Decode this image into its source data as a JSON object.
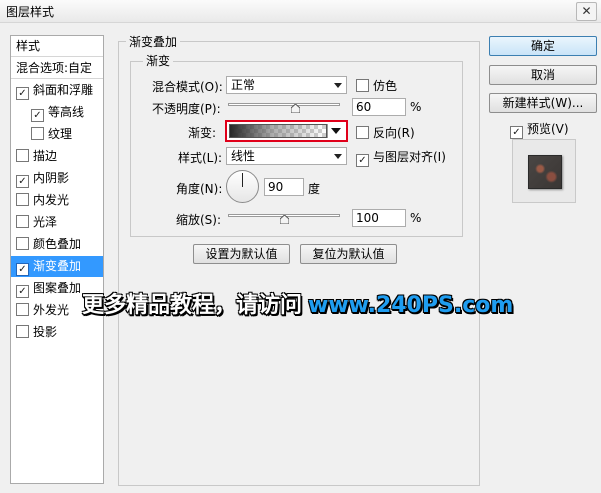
{
  "window": {
    "title": "图层样式",
    "close_glyph": "✕"
  },
  "left_list": {
    "header": "样式",
    "blend_options": "混合选项:自定",
    "items": [
      {
        "label": "斜面和浮雕",
        "checked": true,
        "indent": false
      },
      {
        "label": "等高线",
        "checked": true,
        "indent": true
      },
      {
        "label": "纹理",
        "checked": false,
        "indent": true
      },
      {
        "label": "描边",
        "checked": false,
        "indent": false
      },
      {
        "label": "内阴影",
        "checked": true,
        "indent": false
      },
      {
        "label": "内发光",
        "checked": false,
        "indent": false
      },
      {
        "label": "光泽",
        "checked": false,
        "indent": false
      },
      {
        "label": "颜色叠加",
        "checked": false,
        "indent": false
      },
      {
        "label": "渐变叠加",
        "checked": true,
        "indent": false,
        "selected": true
      },
      {
        "label": "图案叠加",
        "checked": true,
        "indent": false
      },
      {
        "label": "外发光",
        "checked": false,
        "indent": false
      },
      {
        "label": "投影",
        "checked": false,
        "indent": false
      }
    ]
  },
  "panel": {
    "group_title": "渐变叠加",
    "sub_title": "渐变",
    "blend_mode_label": "混合模式(O):",
    "blend_mode_value": "正常",
    "dither_label": "仿色",
    "opacity_label": "不透明度(P):",
    "opacity_value": "60",
    "opacity_fraction": 0.6,
    "percent": "%",
    "gradient_label": "渐变:",
    "reverse_label": "反向(R)",
    "style_label": "样式(L):",
    "style_value": "线性",
    "align_label": "与图层对齐(I)",
    "angle_label": "角度(N):",
    "angle_value": "90",
    "degree_unit": "度",
    "scale_label": "缩放(S):",
    "scale_value": "100",
    "scale_fraction": 0.5,
    "set_default": "设置为默认值",
    "reset_default": "复位为默认值"
  },
  "right": {
    "ok": "确定",
    "cancel": "取消",
    "new_style": "新建样式(W)...",
    "preview_label": "预览(V)"
  },
  "watermark": {
    "text": "更多精品教程，请访问",
    "url": "www.240PS.com"
  },
  "colors": {
    "selection": "#3399ff",
    "highlight_border": "#e0001a",
    "watermark_url": "#1f9df0"
  }
}
